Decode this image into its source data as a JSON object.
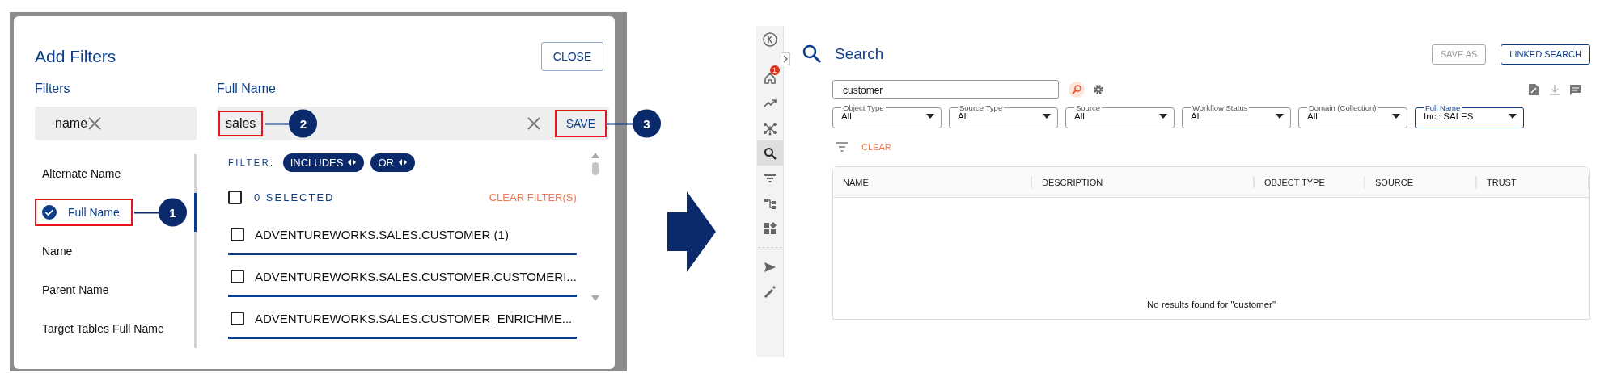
{
  "left_screenshot": {
    "dialog": {
      "title": "Add Filters",
      "close_button": "CLOSE",
      "filters_heading": "Filters",
      "filter_search": {
        "value": "name"
      },
      "filter_list": [
        {
          "label": "Alternate Name",
          "selected": false,
          "highlighted": false
        },
        {
          "label": "Full Name",
          "selected": true,
          "highlighted": true,
          "callout": "1"
        },
        {
          "label": "Name",
          "selected": false,
          "highlighted": false
        },
        {
          "label": "Parent Name",
          "selected": false,
          "highlighted": false
        },
        {
          "label": "Target Tables Full Name",
          "selected": false,
          "highlighted": false
        }
      ],
      "detail_heading": "Full Name",
      "detail_search": {
        "value": "sales",
        "highlighted": true,
        "callout": "2"
      },
      "save_button": {
        "label": "SAVE",
        "highlighted": true,
        "callout": "3"
      },
      "filter_label": "FILTER:",
      "chips": [
        "INCLUDES",
        "OR"
      ],
      "select_all_checked": false,
      "selected_count": "0 SELECTED",
      "clear_filters": "CLEAR FILTER(S)",
      "values": [
        {
          "label": "ADVENTUREWORKS.SALES.CUSTOMER (1)",
          "checked": false
        },
        {
          "label": "ADVENTUREWORKS.SALES.CUSTOMER.CUSTOMERI...",
          "checked": false
        },
        {
          "label": "ADVENTUREWORKS.SALES.CUSTOMER_ENRICHME...",
          "checked": false
        }
      ]
    }
  },
  "right_screenshot": {
    "sidebar": [
      {
        "kind": "home",
        "selected": false,
        "badge": "1"
      },
      {
        "kind": "trend",
        "selected": false
      },
      {
        "kind": "hub",
        "selected": false
      },
      {
        "kind": "search",
        "selected": true
      },
      {
        "kind": "filter",
        "selected": false
      },
      {
        "kind": "tree",
        "selected": false
      },
      {
        "kind": "widgets",
        "selected": false
      },
      {
        "kind": "divider"
      },
      {
        "kind": "send",
        "selected": false
      },
      {
        "kind": "wand",
        "selected": false
      }
    ],
    "title": "Search",
    "buttons": [
      {
        "label": "SAVE AS",
        "disabled": true
      },
      {
        "label": "LINKED SEARCH",
        "disabled": false
      }
    ],
    "search": {
      "value": "customer"
    },
    "dropdowns": [
      {
        "label": "Object Type",
        "value": "All",
        "active": false
      },
      {
        "label": "Source Type",
        "value": "All",
        "active": false
      },
      {
        "label": "Source",
        "value": "All",
        "active": false
      },
      {
        "label": "Workflow Status",
        "value": "All",
        "active": false
      },
      {
        "label": "Domain (Collection)",
        "value": "All",
        "active": false
      },
      {
        "label": "Full Name",
        "value": "Incl: SALES",
        "active": true
      }
    ],
    "clear": "CLEAR",
    "table": {
      "columns": [
        "NAME",
        "DESCRIPTION",
        "OBJECT TYPE",
        "SOURCE",
        "TRUST"
      ],
      "empty_message": "No results found for \"customer\""
    }
  }
}
